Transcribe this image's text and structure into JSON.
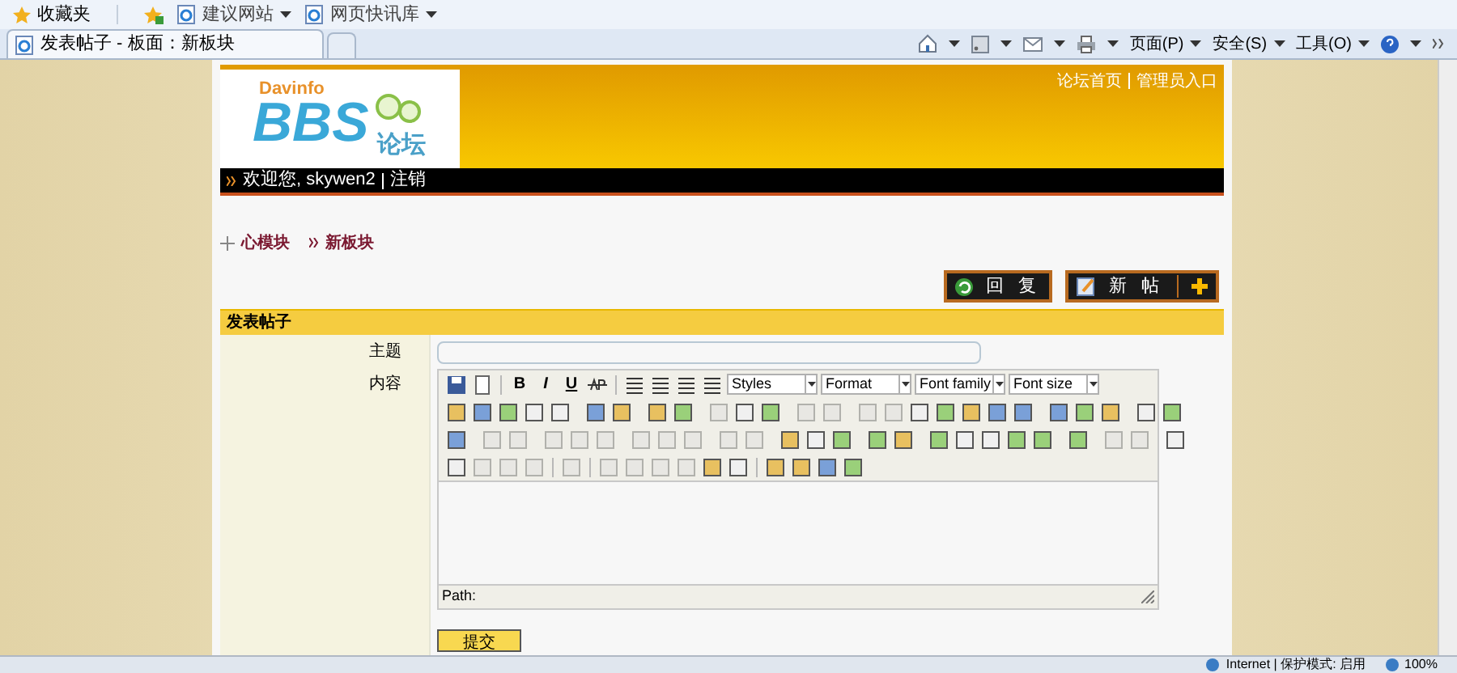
{
  "favorites_bar": {
    "favorites": "收藏夹",
    "links": [
      "建议网站",
      "网页快讯库"
    ]
  },
  "tab": {
    "title": "发表帖子 - 板面：新板块",
    "selected": true
  },
  "command_bar": {
    "menus": [
      "页面(P)",
      "安全(S)",
      "工具(O)"
    ]
  },
  "header": {
    "logo_small": "Davinfo",
    "logo_big": "BBS",
    "logo_cn": "论坛",
    "links": [
      "论坛首页",
      "管理员入口"
    ]
  },
  "user_bar": {
    "welcome": "欢迎您, skywen2",
    "logout": "注销"
  },
  "breadcrumb": [
    "心模块",
    "新板块"
  ],
  "actions": [
    "回 复",
    "新 帖"
  ],
  "form": {
    "title": "发表帖子",
    "subject_label": "主题",
    "content_label": "内容",
    "editor": {
      "text_buttons": [
        "B",
        "I",
        "U"
      ],
      "selects": [
        "Styles",
        "Format",
        "Font family",
        "Font size"
      ],
      "path": "Path:"
    },
    "submit": "提交"
  },
  "status_bar": {
    "zone": "Internet | 保护模式: 启用",
    "zoom": "100%"
  }
}
